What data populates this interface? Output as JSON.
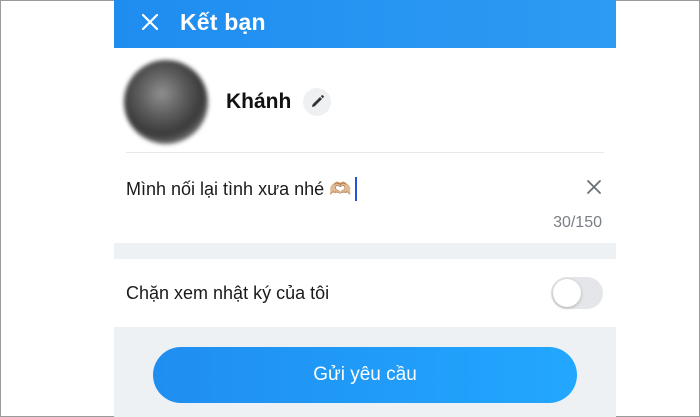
{
  "header": {
    "title": "Kết bạn",
    "close_icon": "close-icon"
  },
  "profile": {
    "name": "Khánh",
    "edit_icon": "pencil-icon"
  },
  "message": {
    "text": "Mình nối lại tình xưa nhé 🫶🏼",
    "counter": "30/150",
    "clear_icon": "close-icon"
  },
  "settings": {
    "block_diary_label": "Chặn xem nhật ký của tôi",
    "block_diary_enabled": false
  },
  "actions": {
    "send_label": "Gửi yêu cầu"
  },
  "colors": {
    "accent": "#1f8df0",
    "background_gray": "#eef1f3"
  }
}
